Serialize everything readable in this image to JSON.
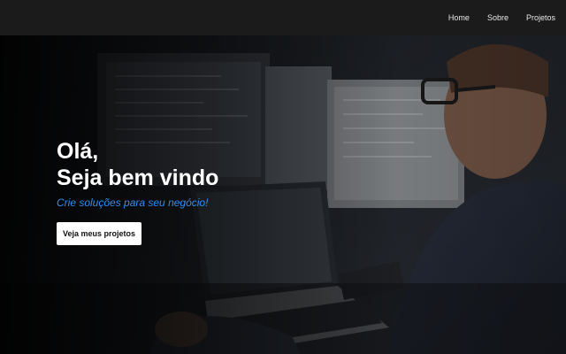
{
  "nav": {
    "items": [
      {
        "label": "Home"
      },
      {
        "label": "Sobre"
      },
      {
        "label": "Projetos"
      }
    ]
  },
  "hero": {
    "title_line1": "Olá,",
    "title_line2": "Seja bem vindo",
    "subtitle": "Crie soluções para seu negócio!",
    "cta_label": "Veja meus projetos",
    "background_image": "developer-at-desk-with-monitors-and-laptop"
  },
  "colors": {
    "navbar": "#1b1b1b",
    "accent": "#2f8ef0",
    "button_bg": "#ffffff",
    "text": "#ffffff"
  }
}
